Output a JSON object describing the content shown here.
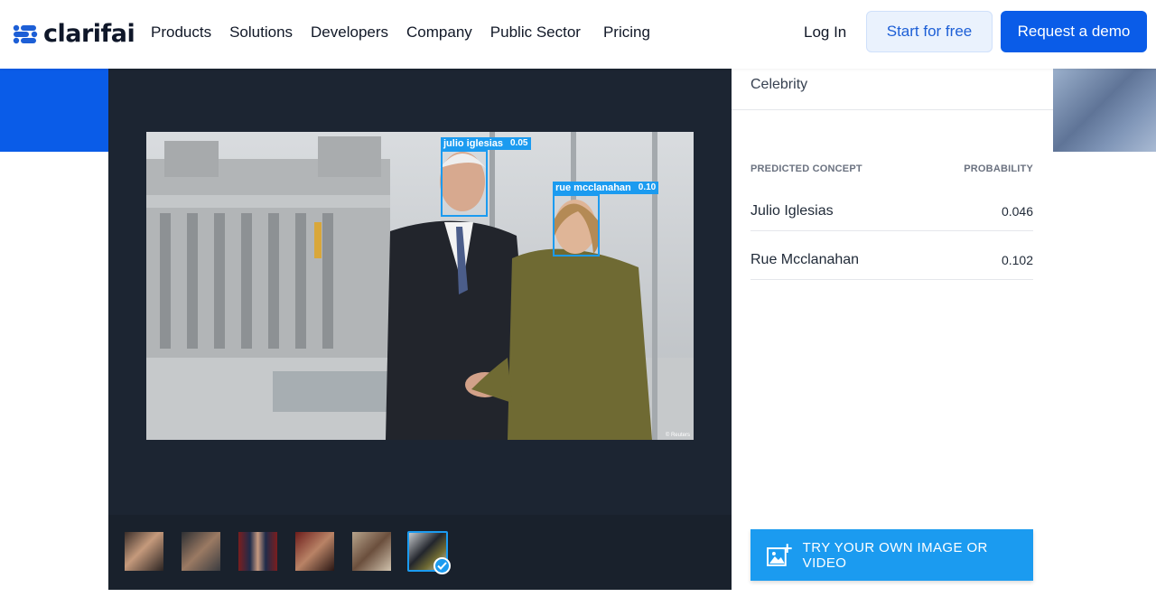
{
  "brand": {
    "name": "clarifai"
  },
  "nav": {
    "items": [
      "Products",
      "Solutions",
      "Developers",
      "Company",
      "Public Sector",
      "Pricing"
    ],
    "login": "Log In",
    "start_free": "Start for free",
    "request_demo": "Request a demo"
  },
  "viewer": {
    "detections": [
      {
        "label": "julio iglesias",
        "score": "0.05"
      },
      {
        "label": "rue mcclanahan",
        "score": "0.10"
      }
    ],
    "photo_credit": "© Reuters",
    "thumbnails_count": 6,
    "selected_thumbnail": 6
  },
  "panel": {
    "model_name": "Celebrity",
    "col_concept": "PREDICTED CONCEPT",
    "col_probability": "PROBABILITY",
    "predictions": [
      {
        "concept": "Julio Iglesias",
        "probability": "0.046"
      },
      {
        "concept": "Rue Mcclanahan",
        "probability": "0.102"
      }
    ],
    "try_button": "TRY YOUR OWN IMAGE OR VIDEO"
  },
  "colors": {
    "brand_blue": "#0a5ce8",
    "accent_blue": "#1b9bf0",
    "viewer_bg": "#1c2532"
  }
}
